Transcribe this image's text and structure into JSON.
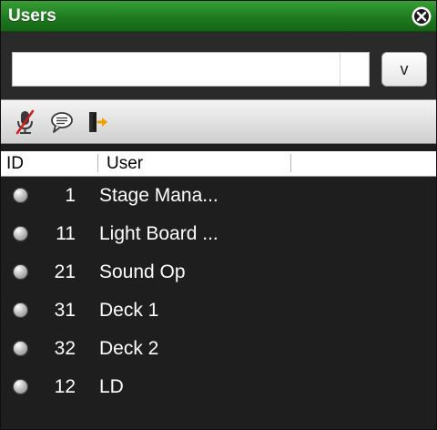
{
  "window": {
    "title": "Users",
    "accent": "#1f7a1f",
    "close_icon": "close-circle-icon"
  },
  "search": {
    "value": "",
    "placeholder": "",
    "button_label": "v"
  },
  "toolbar": {
    "icons": [
      "mute-microphone-icon",
      "chat-bubble-icon",
      "exit-door-icon"
    ]
  },
  "table": {
    "columns": [
      "ID",
      "User"
    ],
    "rows": [
      {
        "id": "1",
        "user": "Stage Mana...",
        "status": "offline"
      },
      {
        "id": "11",
        "user": "Light Board ...",
        "status": "offline"
      },
      {
        "id": "21",
        "user": "Sound Op",
        "status": "offline"
      },
      {
        "id": "31",
        "user": "Deck 1",
        "status": "offline"
      },
      {
        "id": "32",
        "user": "Deck 2",
        "status": "offline"
      },
      {
        "id": "12",
        "user": "LD",
        "status": "offline"
      }
    ]
  }
}
